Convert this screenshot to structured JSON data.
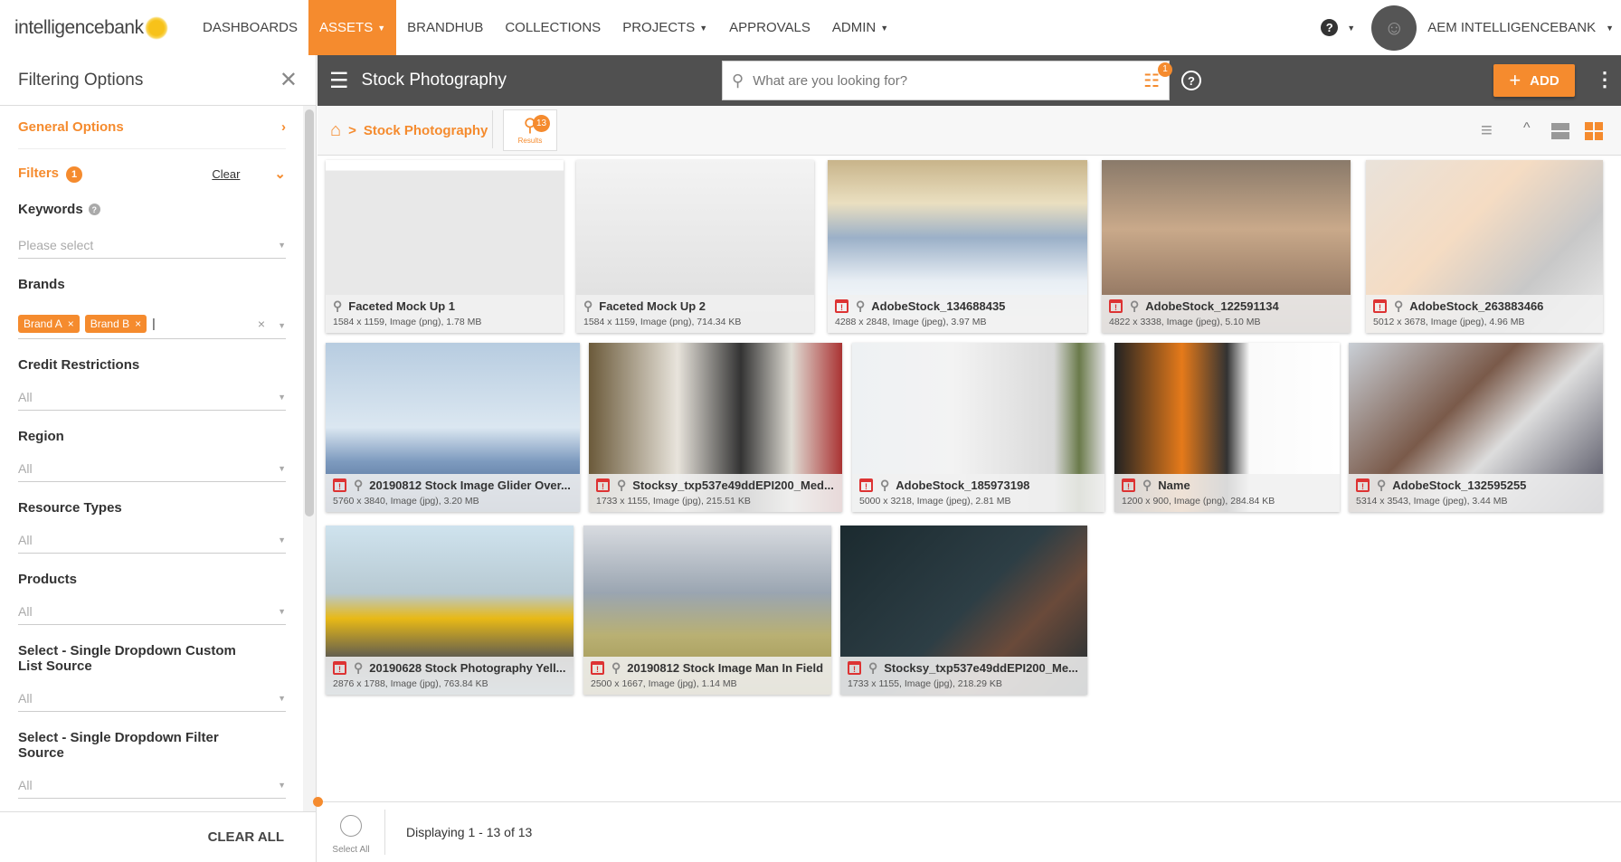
{
  "brand": {
    "logo_text": "intelligencebank"
  },
  "nav": {
    "items": [
      {
        "label": "DASHBOARDS"
      },
      {
        "label": "ASSETS",
        "active": true,
        "dropdown": true
      },
      {
        "label": "BRANDHUB"
      },
      {
        "label": "COLLECTIONS"
      },
      {
        "label": "PROJECTS",
        "dropdown": true
      },
      {
        "label": "APPROVALS"
      },
      {
        "label": "ADMIN",
        "dropdown": true
      }
    ],
    "help_icon": "question-icon",
    "user": "AEM INTELLIGENCEBANK"
  },
  "sidebar": {
    "title": "Filtering Options",
    "general_options": "General Options",
    "filters_label": "Filters",
    "filters_count": "1",
    "clear": "Clear",
    "fields": [
      {
        "label": "Keywords",
        "value": "Please select"
      },
      {
        "label": "Brands",
        "chips": [
          "Brand A",
          "Brand B"
        ]
      },
      {
        "label": "Credit Restrictions",
        "value": "All"
      },
      {
        "label": "Region",
        "value": "All"
      },
      {
        "label": "Resource Types",
        "value": "All"
      },
      {
        "label": "Products",
        "value": "All"
      },
      {
        "label": "Select - Single Dropdown Custom List Source",
        "value": "All"
      },
      {
        "label": "Select - Single Dropdown Filter Source",
        "value": "All"
      }
    ],
    "clear_all": "CLEAR ALL"
  },
  "header": {
    "title": "Stock Photography",
    "search_placeholder": "What are you looking for?",
    "filter_badge": "1",
    "add_label": "ADD"
  },
  "breadcrumb": {
    "current": "Stock Photography",
    "results_count": "13",
    "results_label": "Results"
  },
  "accent": "#f58b2e",
  "assets": [
    {
      "name": "Faceted Mock Up 1",
      "meta": "1584 x 1159, Image (png), 1.78 MB",
      "alert": false
    },
    {
      "name": "Faceted Mock Up 2",
      "meta": "1584 x 1159, Image (png), 714.34 KB",
      "alert": false
    },
    {
      "name": "AdobeStock_134688435",
      "meta": "4288 x 2848, Image (jpeg), 3.97 MB",
      "alert": true
    },
    {
      "name": "AdobeStock_122591134",
      "meta": "4822 x 3338, Image (jpeg), 5.10 MB",
      "alert": true
    },
    {
      "name": "AdobeStock_263883466",
      "meta": "5012 x 3678, Image (jpeg), 4.96 MB",
      "alert": true
    },
    {
      "name": "20190812 Stock Image Glider Over...",
      "meta": "5760 x 3840, Image (jpg), 3.20 MB",
      "alert": true
    },
    {
      "name": "Stocksy_txp537e49ddEPI200_Med...",
      "meta": "1733 x 1155, Image (jpg), 215.51 KB",
      "alert": true
    },
    {
      "name": "AdobeStock_185973198",
      "meta": "5000 x 3218, Image (jpeg), 2.81 MB",
      "alert": true
    },
    {
      "name": "Name",
      "meta": "1200 x 900, Image (png), 284.84 KB",
      "alert": true
    },
    {
      "name": "AdobeStock_132595255",
      "meta": "5314 x 3543, Image (jpeg), 3.44 MB",
      "alert": true
    },
    {
      "name": "20190628 Stock Photography Yell...",
      "meta": "2876 x 1788, Image (jpg), 763.84 KB",
      "alert": true
    },
    {
      "name": "20190812 Stock Image Man In Field",
      "meta": "2500 x 1667, Image (jpg), 1.14 MB",
      "alert": true
    },
    {
      "name": "Stocksy_txp537e49ddEPI200_Me...",
      "meta": "1733 x 1155, Image (jpg), 218.29 KB",
      "alert": true
    }
  ],
  "footer": {
    "select_all": "Select All",
    "displaying": "Displaying 1 - 13 of 13"
  }
}
